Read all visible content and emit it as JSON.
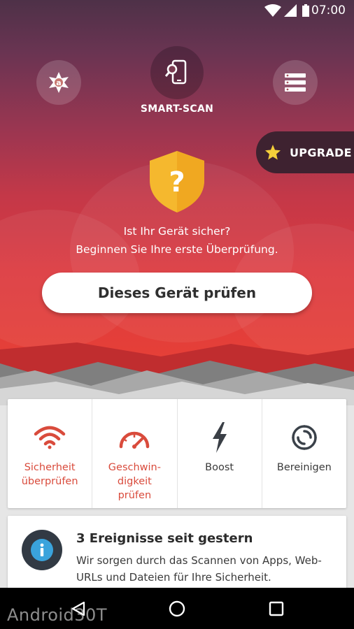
{
  "status_bar": {
    "time": "07:00",
    "icons": [
      "wifi-icon",
      "cell-signal-icon",
      "battery-icon"
    ]
  },
  "top_nav": {
    "left_icon": "avast-logo-icon",
    "center_icon": "phone-scan-icon",
    "center_label": "SMART-SCAN",
    "right_icon": "menu-list-icon"
  },
  "upgrade": {
    "label": "UPGRADE",
    "icon": "star-icon"
  },
  "status": {
    "shield_symbol": "?",
    "line1": "Ist Ihr Gerät sicher?",
    "line2": "Beginnen Sie Ihre erste Überprüfung."
  },
  "scan_button": {
    "label": "Dieses Gerät prüfen"
  },
  "features": [
    {
      "label": "Sicherheit\nüberprüfen",
      "icon": "wifi-security-icon",
      "color": "#d94b3c"
    },
    {
      "label": "Geschwin-\ndigkeit\nprüfen",
      "icon": "speedometer-icon",
      "color": "#d94b3c"
    },
    {
      "label": "Boost",
      "icon": "lightning-icon",
      "color": "#3a3a3a"
    },
    {
      "label": "Bereinigen",
      "icon": "swirl-clean-icon",
      "color": "#3a3a3a"
    }
  ],
  "event_card": {
    "icon": "info-icon",
    "title": "3 Ereignisse seit gestern",
    "description": "Wir sorgen durch das Scannen von Apps, Web-URLs und Dateien für Ihre Sicherheit."
  },
  "watermark": "Android30T",
  "colors": {
    "accent_red": "#d94b3c",
    "shield_yellow": "#f5b82e",
    "upgrade_bg": "#3e2230"
  }
}
